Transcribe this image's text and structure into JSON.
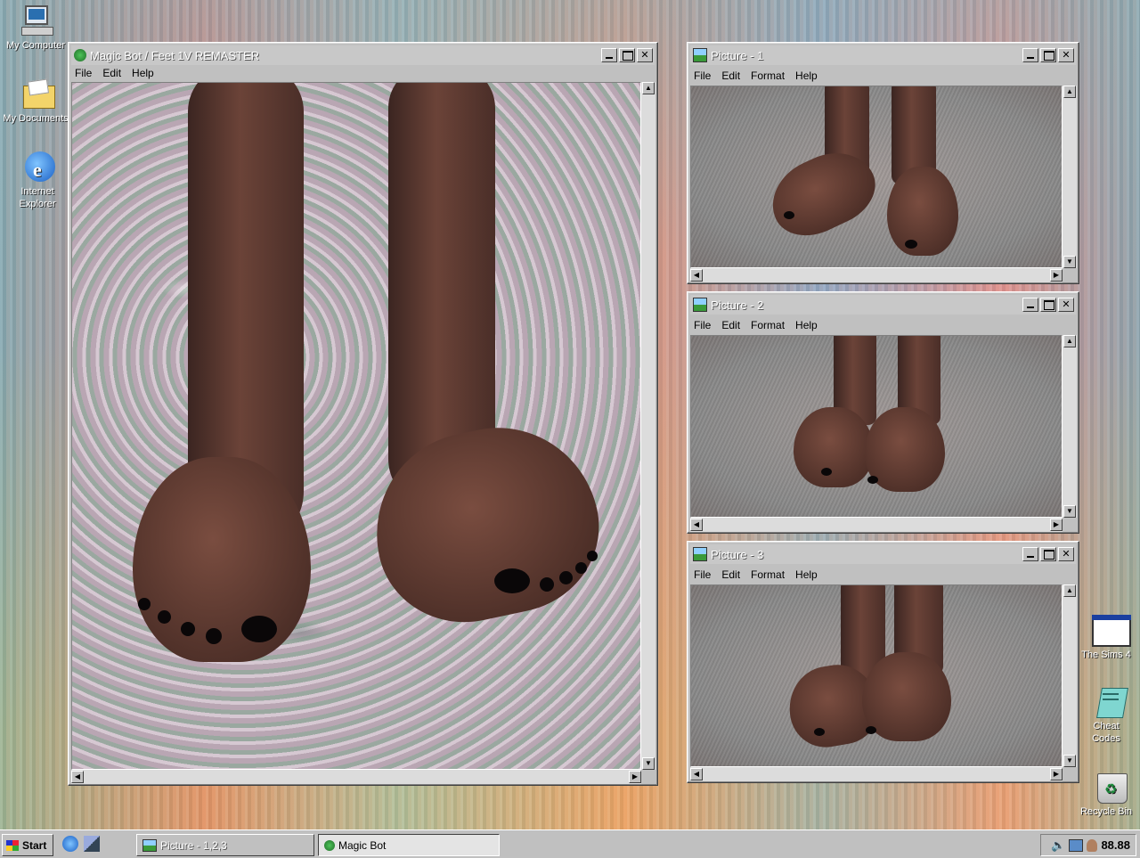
{
  "desktop": {
    "icons": [
      {
        "label": "My Computer"
      },
      {
        "label": "My Documents"
      },
      {
        "label": "Internet Explorer"
      },
      {
        "label": "The Sims 4"
      },
      {
        "label": "Cheat Codes"
      },
      {
        "label": "Recycle Bin"
      }
    ]
  },
  "main_window": {
    "title": "Magic Bot / Feet 1V REMASTER",
    "menu": [
      "File",
      "Edit",
      "Help"
    ]
  },
  "picture_windows": [
    {
      "title": "Picture - 1",
      "menu": [
        "File",
        "Edit",
        "Format",
        "Help"
      ]
    },
    {
      "title": "Picture - 2",
      "menu": [
        "File",
        "Edit",
        "Format",
        "Help"
      ]
    },
    {
      "title": "Picture - 3",
      "menu": [
        "File",
        "Edit",
        "Format",
        "Help"
      ]
    }
  ],
  "taskbar": {
    "start_label": "Start",
    "buttons": [
      {
        "label": "Picture - 1,2,3"
      },
      {
        "label": "Magic Bot"
      }
    ],
    "clock": "88.88"
  },
  "colors": {
    "titlebar": "#c8c8c8",
    "window_face": "#c0c0c0",
    "nail_polish": "#0a0708",
    "skin": "#6b4338"
  },
  "icons": {
    "window_icon_main": "green-shield-icon",
    "window_icon_picture": "picture-icon",
    "minimize": "minimize-icon",
    "maximize": "maximize-icon",
    "close": "close-icon"
  }
}
